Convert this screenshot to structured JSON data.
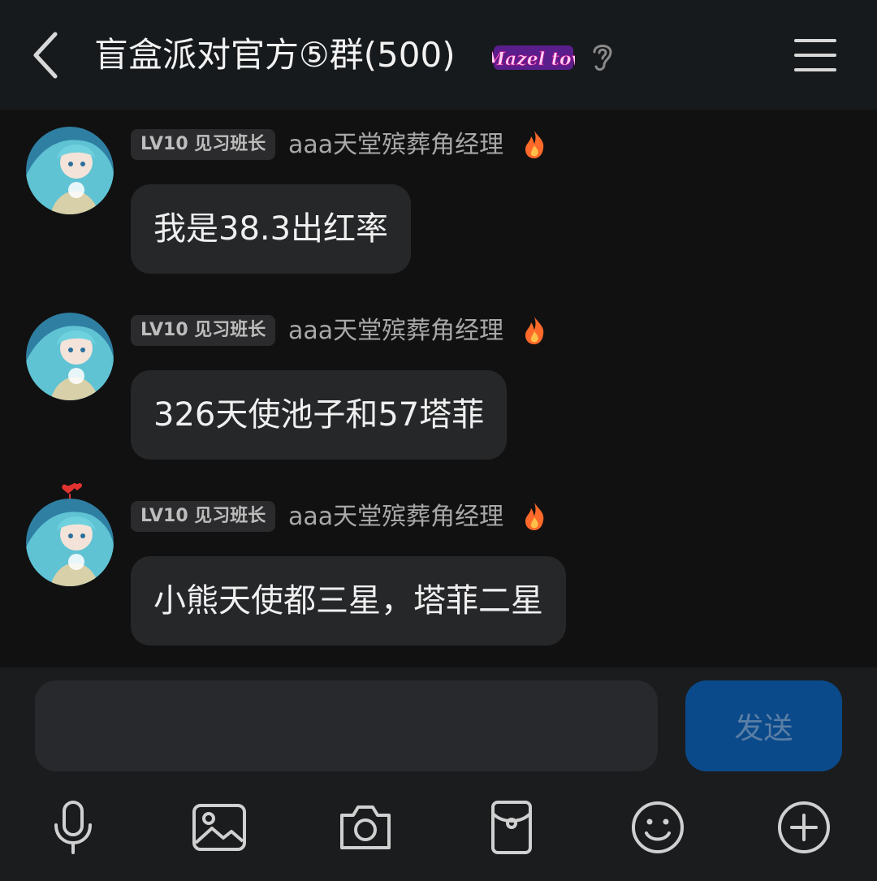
{
  "header": {
    "title": "盲盒派对官方⑤群(500)",
    "badge_text": "Mazel tov",
    "icons": [
      "back-arrow-icon",
      "ear-icon",
      "hamburger-menu-icon"
    ]
  },
  "messages": [
    {
      "level": "LV10 见习班长",
      "username": "aaa天堂殡葬角经理",
      "text": "我是38.3出红率"
    },
    {
      "level": "LV10 见习班长",
      "username": "aaa天堂殡葬角经理",
      "text": "326天使池子和57塔菲"
    },
    {
      "level": "LV10 见习班长",
      "username": "aaa天堂殡葬角经理",
      "text": "小熊天使都三星，塔菲二星"
    }
  ],
  "composer": {
    "input_value": "",
    "send_label": "发送"
  },
  "toolbar": [
    "microphone-icon",
    "image-icon",
    "camera-icon",
    "red-packet-icon",
    "emoji-icon",
    "plus-icon"
  ],
  "colors": {
    "background": "#111111",
    "header": "#171a1d",
    "bubble": "#262729",
    "send_button": "#0b4a8a",
    "fire": "#ff6a2a"
  }
}
